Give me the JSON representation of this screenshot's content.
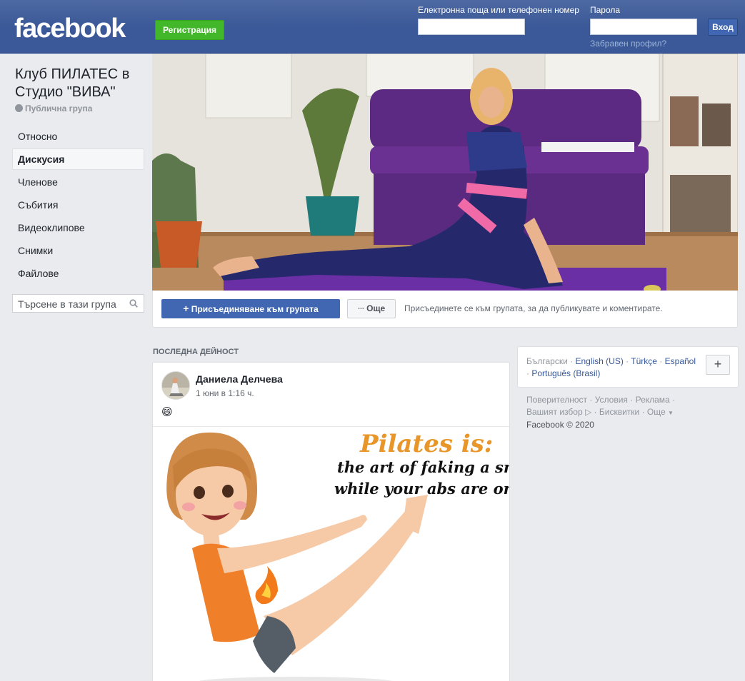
{
  "header": {
    "logo": "facebook",
    "signup_label": "Регистрация",
    "email_label": "Електронна поща или телефонен номер",
    "password_label": "Парола",
    "email_value": "",
    "password_value": "",
    "login_label": "Вход",
    "forgot_label": "Забравен профил?"
  },
  "group": {
    "title": "Клуб ПИЛАТЕС в Студио \"ВИВА\"",
    "type": "Публична група"
  },
  "sidebar": {
    "items": [
      {
        "label": "Относно"
      },
      {
        "label": "Дискусия",
        "active": true
      },
      {
        "label": "Членове"
      },
      {
        "label": "Събития"
      },
      {
        "label": "Видеоклипове"
      },
      {
        "label": "Снимки"
      },
      {
        "label": "Файлове"
      }
    ],
    "search_placeholder": "Търсене в тази група"
  },
  "cover_actions": {
    "join_label": "Присъединяване към групата",
    "more_label": "Още",
    "hint": "Присъединете се към групата, за да публикувате и коментирате."
  },
  "feed": {
    "section_label": "ПОСЛЕДНА ДЕЙНОСТ",
    "post": {
      "author": "Даниела Делчева",
      "time": "1 юни в 1:16 ч.",
      "text": "😄",
      "image_text": {
        "title": "Pilates is:",
        "line1": "the art of faking a smile",
        "line2_prefix": "while your abs are on ",
        "line2_fire": "fire"
      }
    }
  },
  "languages": {
    "current": "Български",
    "links": [
      "English (US)",
      "Türkçe",
      "Español",
      "Português (Brasil)"
    ],
    "add_label": "+"
  },
  "footer": {
    "links": [
      "Поверителност",
      "Условия",
      "Реклама",
      "Вашият избор",
      "Бисквитки",
      "Още"
    ],
    "copyright": "Facebook © 2020"
  },
  "colors": {
    "topbar": "#3b5998",
    "signup": "#42b72a",
    "primary_button": "#4267b2",
    "link": "#365899",
    "background": "#e9ebee"
  }
}
